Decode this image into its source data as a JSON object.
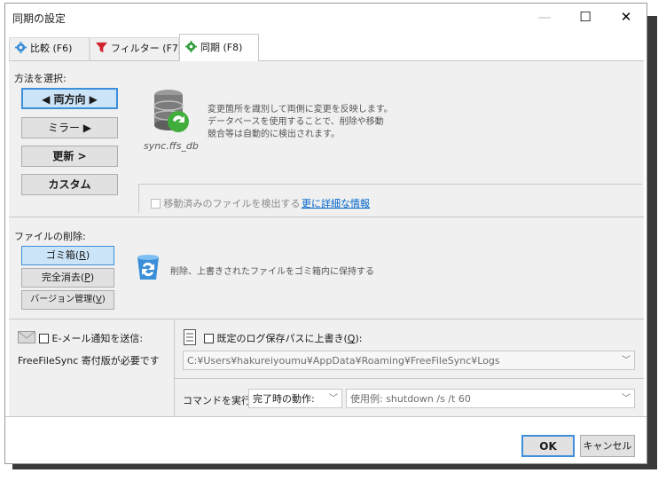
{
  "window": {
    "title": "同期の設定",
    "minimize": "—",
    "maximize": "☐",
    "close": "✕"
  },
  "tabs": [
    {
      "label": "比較 (F6)",
      "icon": "gear-icon"
    },
    {
      "label": "フィルター (F7)",
      "icon": "filter-icon"
    },
    {
      "label": "同期 (F8)",
      "icon": "gear-icon"
    }
  ],
  "method": {
    "heading": "方法を選択:",
    "buttons": [
      "◀ 両方向 ▶",
      "ミラー ▶",
      "更新 >",
      "カスタム"
    ],
    "selected": 0,
    "description_lines": [
      "変更箇所を識別して両側に変更を反映します。",
      "データベースを使用することで、削除や移動",
      "競合等は自動的に検出されます。"
    ],
    "db_caption": "sync.ffs_db",
    "detect_moved": "移動済みのファイルを検出する",
    "more_info": "更に詳細な情報"
  },
  "deletion": {
    "heading": "ファイルの削除:",
    "buttons": [
      {
        "pre": "ゴミ箱(",
        "key": "R",
        "post": ")"
      },
      {
        "pre": "完全消去(",
        "key": "P",
        "post": ")"
      },
      {
        "pre": "バージョン管理(",
        "key": "V",
        "post": ")"
      }
    ],
    "description": "削除、上書きされたファイルをゴミ箱内に保持する"
  },
  "email": {
    "label": "E-メール通知を送信:",
    "note": "FreeFileSync 寄付版が必要です"
  },
  "log": {
    "label_pre": "既定のログ保存パスに上書き(",
    "label_key": "Q",
    "label_post": "):",
    "path": "C:¥Users¥hakureiyoumu¥AppData¥Roaming¥FreeFileSync¥Logs"
  },
  "command": {
    "label": "コマンドを実行:",
    "when": "完了時の動作:",
    "placeholder": "使用例: shutdown /s /t 60"
  },
  "footer": {
    "ok": "OK",
    "cancel": "キャンセル"
  }
}
